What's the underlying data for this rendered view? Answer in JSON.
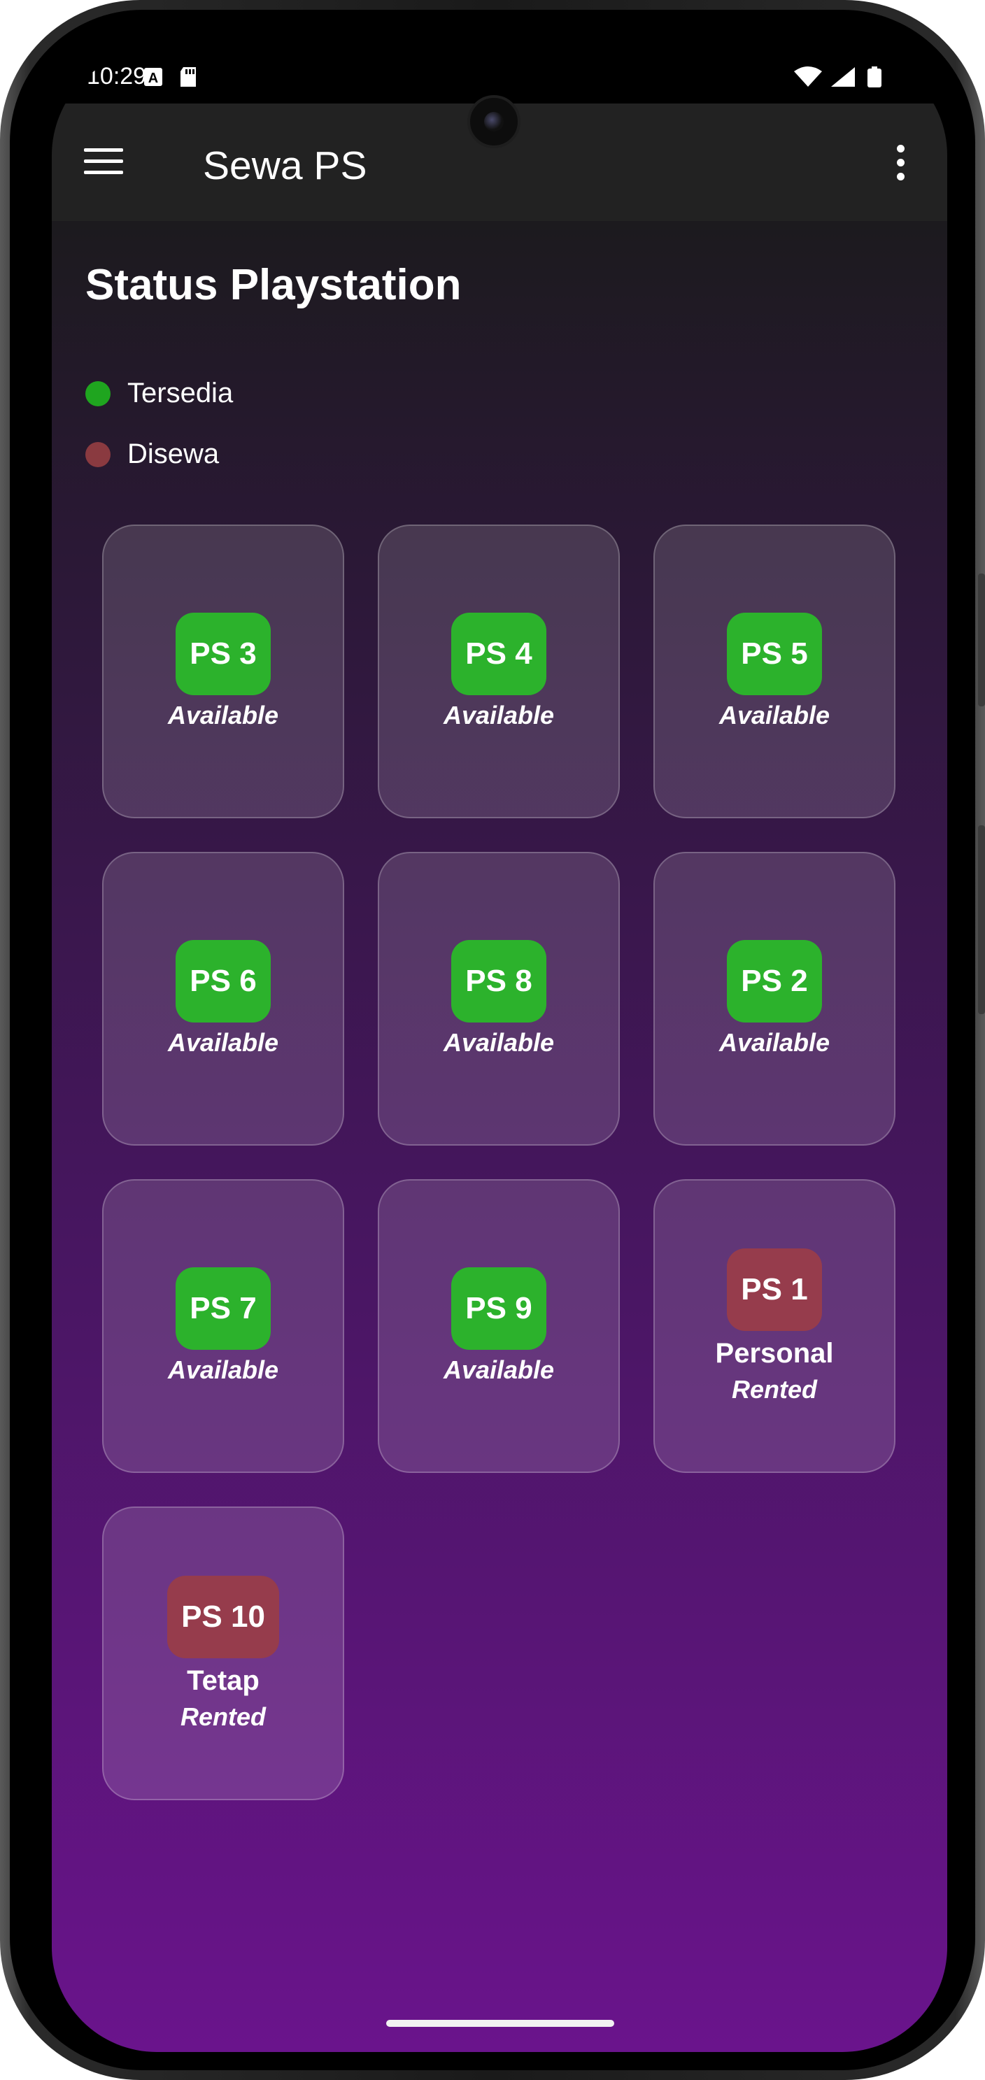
{
  "status_bar": {
    "time": "10:29",
    "left_icons": [
      "a-notification-icon",
      "sd-card-icon"
    ],
    "right_icons": [
      "wifi-icon",
      "cellular-signal-icon",
      "battery-icon"
    ]
  },
  "app_bar": {
    "title": "Sewa PS",
    "menu_icon": "hamburger-menu-icon",
    "overflow_icon": "more-vertical-icon"
  },
  "section": {
    "title": "Status Playstation",
    "legend": [
      {
        "label": "Tersedia",
        "color": "#1fa51f"
      },
      {
        "label": "Disewa",
        "color": "#8a3a40"
      }
    ]
  },
  "colors": {
    "available": "#2cb22c",
    "rented": "#963c4c"
  },
  "consoles": [
    {
      "name": "PS 3",
      "status": "Available",
      "state": "available",
      "type": ""
    },
    {
      "name": "PS 4",
      "status": "Available",
      "state": "available",
      "type": ""
    },
    {
      "name": "PS 5",
      "status": "Available",
      "state": "available",
      "type": ""
    },
    {
      "name": "PS 6",
      "status": "Available",
      "state": "available",
      "type": ""
    },
    {
      "name": "PS 8",
      "status": "Available",
      "state": "available",
      "type": ""
    },
    {
      "name": "PS 2",
      "status": "Available",
      "state": "available",
      "type": ""
    },
    {
      "name": "PS 7",
      "status": "Available",
      "state": "available",
      "type": ""
    },
    {
      "name": "PS 9",
      "status": "Available",
      "state": "available",
      "type": ""
    },
    {
      "name": "PS 1",
      "status": "Rented",
      "state": "rented",
      "type": "Personal"
    },
    {
      "name": "PS 10",
      "status": "Rented",
      "state": "rented",
      "type": "Tetap"
    }
  ]
}
